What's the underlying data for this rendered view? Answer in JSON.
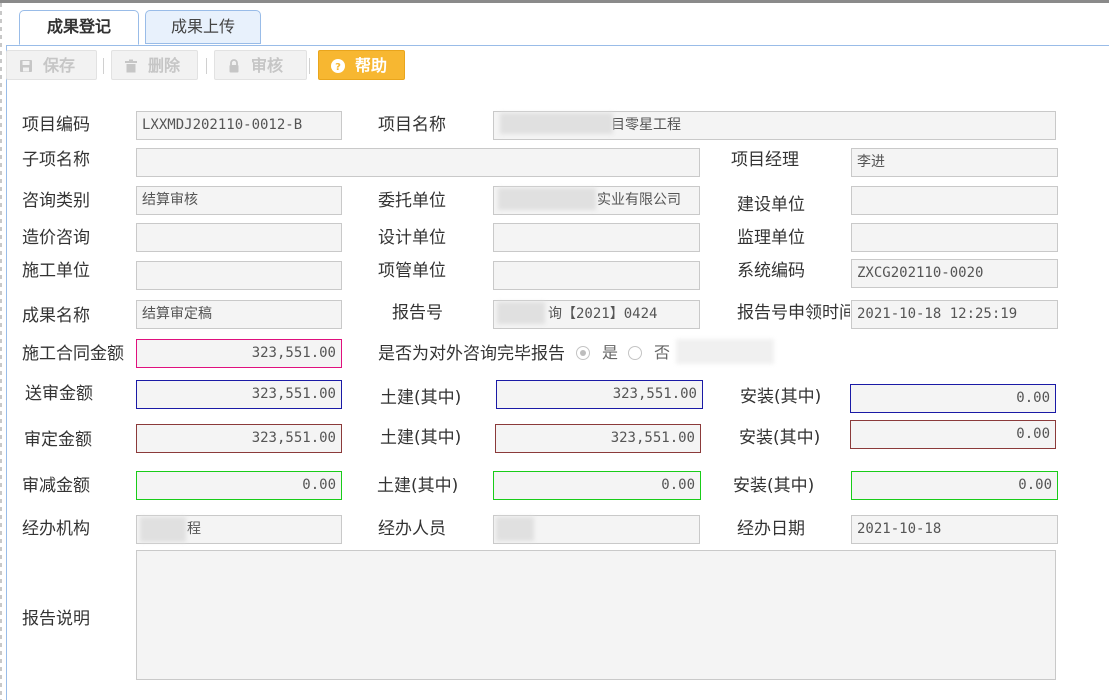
{
  "tabs": [
    {
      "label": "成果登记",
      "active": true
    },
    {
      "label": "成果上传",
      "active": false
    }
  ],
  "toolbar": {
    "save_label": "保存",
    "delete_label": "删除",
    "audit_label": "审核",
    "help_label": "帮助"
  },
  "labels": {
    "project_code": "项目编码",
    "project_name": "项目名称",
    "sub_item_name": "子项名称",
    "project_manager": "项目经理",
    "consult_type": "咨询类别",
    "client_unit": "委托单位",
    "construction_unit": "建设单位",
    "cost_consult": "造价咨询",
    "design_unit": "设计单位",
    "supervision_unit": "监理单位",
    "builder_unit": "施工单位",
    "project_mgmt_unit": "项管单位",
    "system_code": "系统编码",
    "result_name": "成果名称",
    "report_no": "报告号",
    "report_apply_time": "报告号申领时间",
    "contract_amount": "施工合同金额",
    "external_report": "是否为对外咨询完毕报告",
    "submitted_amount": "送审金额",
    "approved_amount": "审定金额",
    "reduced_amount": "审减金额",
    "civil_of": "土建(其中)",
    "install_of": "安装(其中)",
    "handling_org": "经办机构",
    "handling_person": "经办人员",
    "handling_date": "经办日期",
    "report_desc": "报告说明"
  },
  "values": {
    "project_code": "LXXMDJ202110-0012-B",
    "project_name_suffix": "目零星工程",
    "sub_item_name": "",
    "project_manager": "李进",
    "consult_type": "结算审核",
    "client_unit_suffix": "实业有限公司",
    "construction_unit": "",
    "cost_consult": "",
    "design_unit": "",
    "supervision_unit": "",
    "builder_unit": "",
    "project_mgmt_unit": "",
    "system_code": "ZXCG202110-0020",
    "result_name": "结算审定稿",
    "report_no_suffix": "询【2021】0424",
    "report_apply_time": "2021-10-18 12:25:19",
    "contract_amount": "323,551.00",
    "external_report_yes": "是",
    "external_report_no": "否",
    "external_report_selected": "是",
    "submitted_amount": "323,551.00",
    "submitted_civil": "323,551.00",
    "submitted_install": "0.00",
    "approved_amount": "323,551.00",
    "approved_civil": "323,551.00",
    "approved_install": "0.00",
    "reduced_amount": "0.00",
    "reduced_civil": "0.00",
    "reduced_install": "0.00",
    "handling_org_suffix": "程",
    "handling_person": "",
    "handling_date": "2021-10-18",
    "report_desc": ""
  },
  "colors": {
    "tab_border": "#99bce8",
    "help_button": "#f7b731",
    "contract_border": "#e0107e",
    "submitted_border": "#1a1aa6",
    "approved_border": "#8b3a3a",
    "reduced_border": "#19cc19"
  }
}
